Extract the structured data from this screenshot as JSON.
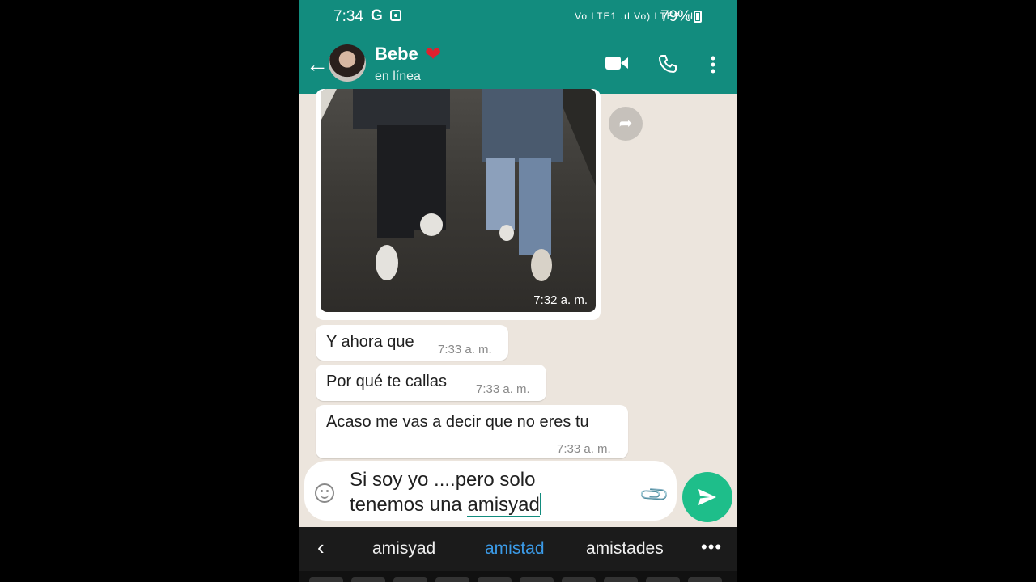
{
  "status_bar": {
    "time": "7:34",
    "carrier_glyph": "G",
    "indicators": "Vo LTE1 .ıl Vo) LTE2 .ıl",
    "battery": "79%"
  },
  "header": {
    "contact_name": "Bebe",
    "status": "en línea",
    "icons": [
      "back-arrow-icon",
      "video-call-icon",
      "phone-icon",
      "more-vert-icon"
    ]
  },
  "chat": {
    "photo_message": {
      "time": "7:32 a. m."
    },
    "messages": [
      {
        "text": "Y ahora que",
        "time": "7:33 a. m."
      },
      {
        "text": "Por qué te callas",
        "time": "7:33 a. m."
      },
      {
        "text": "Acaso me vas a decir que no eres tu",
        "time": "7:33 a. m."
      }
    ]
  },
  "composer": {
    "line1": "Si soy yo ....pero solo",
    "line2_prefix": "tenemos una ",
    "line2_word": "amisyad"
  },
  "keyboard": {
    "suggestions": [
      "amisyad",
      "amistad",
      "amistades"
    ],
    "selected_index": 1,
    "more": "•••"
  },
  "colors": {
    "header": "#128c7e",
    "send_button": "#1ebe8a",
    "chat_bg": "#ece5dd",
    "selected_suggestion": "#3b9be8",
    "heart": "#e0202e"
  }
}
